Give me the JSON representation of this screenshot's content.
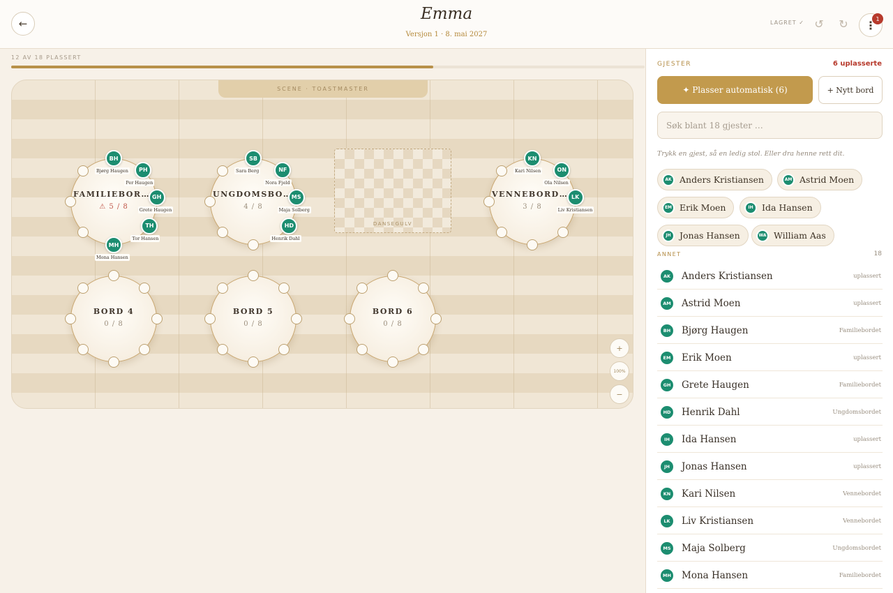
{
  "header": {
    "title": "Emma",
    "subtitle": "Versjon 1 · 8. mai 2027",
    "saved": "LAGRET ✓",
    "notifications": "1"
  },
  "progress": {
    "label": "12 AV 18 PLASSERT",
    "placed": 12,
    "total": 18
  },
  "floor": {
    "stage_label": "SCENE · TOASTMASTER",
    "dance_label": "DANSEGULV",
    "zoom_in": "+",
    "zoom_level": "100%",
    "zoom_out": "−",
    "tables": [
      {
        "name": "FAMILIEBORDE...",
        "count": "⚠ 5 / 8",
        "warn": true,
        "guests": [
          {
            "seat": 0,
            "initials": "BH",
            "name": "Bjørg Haugen"
          },
          {
            "seat": 1,
            "initials": "PH",
            "name": "Per Haugen"
          },
          {
            "seat": 2,
            "initials": "GH",
            "name": "Grete Haugen"
          },
          {
            "seat": 3,
            "initials": "TH",
            "name": "Tor Hansen"
          },
          {
            "seat": 4,
            "initials": "MH",
            "name": "Mona Hansen"
          }
        ]
      },
      {
        "name": "UNGDOMSBOR...",
        "count": "4 / 8",
        "warn": false,
        "guests": [
          {
            "seat": 0,
            "initials": "SB",
            "name": "Sara Berg"
          },
          {
            "seat": 1,
            "initials": "NF",
            "name": "Nora Fjeld"
          },
          {
            "seat": 2,
            "initials": "MS",
            "name": "Maja Solberg"
          },
          {
            "seat": 3,
            "initials": "HD",
            "name": "Henrik Dahl"
          }
        ]
      },
      {
        "name": "VENNEBORDET",
        "count": "3 / 8",
        "warn": false,
        "guests": [
          {
            "seat": 0,
            "initials": "KN",
            "name": "Kari Nilsen"
          },
          {
            "seat": 1,
            "initials": "ON",
            "name": "Ola Nilsen"
          },
          {
            "seat": 2,
            "initials": "LK",
            "name": "Liv Kristiansen"
          }
        ]
      },
      {
        "name": "BORD 4",
        "count": "0 / 8",
        "warn": false,
        "guests": []
      },
      {
        "name": "BORD 5",
        "count": "0 / 8",
        "warn": false,
        "guests": []
      },
      {
        "name": "BORD 6",
        "count": "0 / 8",
        "warn": false,
        "guests": []
      }
    ]
  },
  "sidebar": {
    "heading": "GJESTER",
    "unplaced_label": "6 uplasserte",
    "auto_button": "✦ Plasser automatisk (6)",
    "new_table_button": "+ Nytt bord",
    "search_placeholder": "Søk blant 18 gjester …",
    "hint": "Trykk en gjest, så en ledig stol. Eller dra henne rett dit.",
    "unplaced": [
      {
        "initials": "AK",
        "name": "Anders Kristiansen"
      },
      {
        "initials": "AM",
        "name": "Astrid Moen"
      },
      {
        "initials": "EM",
        "name": "Erik Moen"
      },
      {
        "initials": "IH",
        "name": "Ida Hansen"
      },
      {
        "initials": "JH",
        "name": "Jonas Hansen"
      },
      {
        "initials": "WA",
        "name": "William Aas"
      }
    ],
    "group": {
      "label": "ANNET",
      "count": "18"
    },
    "rows": [
      {
        "initials": "AK",
        "name": "Anders Kristiansen",
        "status": "uplassert"
      },
      {
        "initials": "AM",
        "name": "Astrid Moen",
        "status": "uplassert"
      },
      {
        "initials": "BH",
        "name": "Bjørg Haugen",
        "status": "Familiebordet"
      },
      {
        "initials": "EM",
        "name": "Erik Moen",
        "status": "uplassert"
      },
      {
        "initials": "GH",
        "name": "Grete Haugen",
        "status": "Familiebordet"
      },
      {
        "initials": "HD",
        "name": "Henrik Dahl",
        "status": "Ungdomsbordet"
      },
      {
        "initials": "IH",
        "name": "Ida Hansen",
        "status": "uplassert"
      },
      {
        "initials": "JH",
        "name": "Jonas Hansen",
        "status": "uplassert"
      },
      {
        "initials": "KN",
        "name": "Kari Nilsen",
        "status": "Vennebordet"
      },
      {
        "initials": "LK",
        "name": "Liv Kristiansen",
        "status": "Vennebordet"
      },
      {
        "initials": "MS",
        "name": "Maja Solberg",
        "status": "Ungdomsbordet"
      },
      {
        "initials": "MH",
        "name": "Mona Hansen",
        "status": "Familiebordet"
      }
    ]
  },
  "icons": {
    "back": "arrow-left-icon",
    "undo": "undo-icon",
    "redo": "redo-icon",
    "more": "more-vertical-icon"
  },
  "colors": {
    "accent": "#c29a4d",
    "guest": "#1c8d70",
    "warning": "#b73a2c"
  }
}
